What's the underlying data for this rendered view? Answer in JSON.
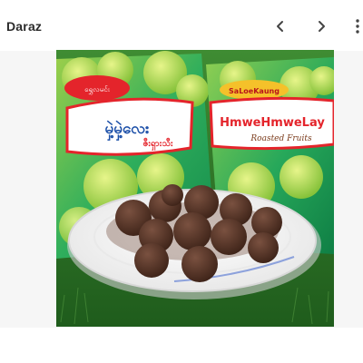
{
  "header": {
    "title": "Daraz",
    "prev_icon": "chevron-left-icon",
    "next_icon": "chevron-right-icon",
    "more_icon": "more-vertical-icon"
  },
  "photo": {
    "left_pack": {
      "brand_line1": "မှဲ့မှဲ့လေး",
      "brand_line2": "ဇီးရှားသီး",
      "badge": "ရွှေလမင်း"
    },
    "right_pack": {
      "maker": "SaLoeKaung",
      "brand": "HmweHmweLay",
      "subtitle": "Roasted Fruits"
    }
  },
  "colors": {
    "accent": "#e4242b",
    "pack_green": "#1aa35a",
    "grass": "#2f7a2a",
    "plate": "#f7f7f7",
    "chocolate": "#5a3626"
  }
}
